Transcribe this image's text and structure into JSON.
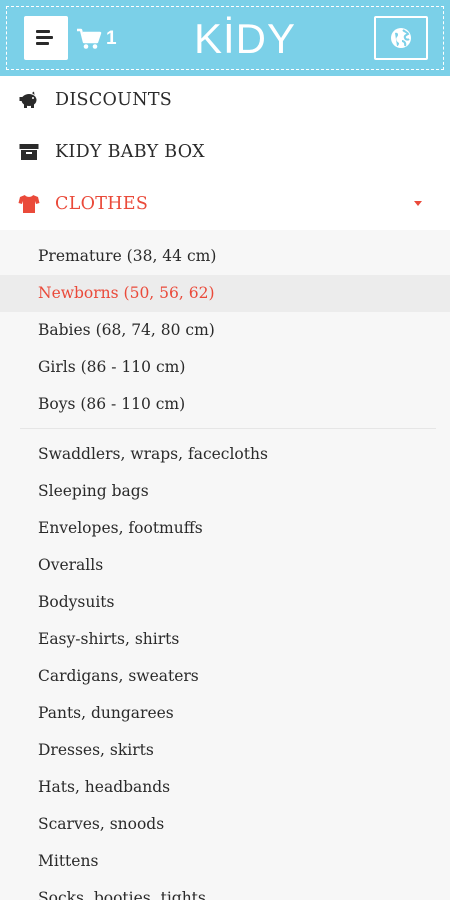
{
  "header": {
    "menu_icon": "hamburger-icon",
    "cart_icon": "cart-icon",
    "cart_count": "1",
    "logo": "KİDY",
    "language_icon": "globe-icon",
    "background_color": "#7bd0e8"
  },
  "nav": {
    "items": [
      {
        "label": "DISCOUNTS",
        "icon": "piggy-bank-icon"
      },
      {
        "label": "KIDY BABY BOX",
        "icon": "box-icon"
      },
      {
        "label": "CLOTHES",
        "icon": "tshirt-icon",
        "active": true,
        "accent_color": "#ea4a3a"
      }
    ]
  },
  "submenu": {
    "sizes": [
      {
        "label": "Premature (38, 44 cm)"
      },
      {
        "label": "Newborns (50, 56, 62)",
        "highlighted": true
      },
      {
        "label": "Babies (68, 74, 80 cm)"
      },
      {
        "label": "Girls (86 - 110 cm)"
      },
      {
        "label": "Boys (86 - 110 cm)"
      }
    ],
    "categories": [
      {
        "label": "Swaddlers, wraps, facecloths"
      },
      {
        "label": "Sleeping bags"
      },
      {
        "label": "Envelopes, footmuffs"
      },
      {
        "label": "Overalls"
      },
      {
        "label": "Bodysuits"
      },
      {
        "label": "Easy-shirts, shirts"
      },
      {
        "label": "Cardigans, sweaters"
      },
      {
        "label": "Pants, dungarees"
      },
      {
        "label": "Dresses, skirts"
      },
      {
        "label": "Hats, headbands"
      },
      {
        "label": "Scarves, snoods"
      },
      {
        "label": "Mittens"
      },
      {
        "label": "Socks, booties, tights"
      }
    ]
  }
}
